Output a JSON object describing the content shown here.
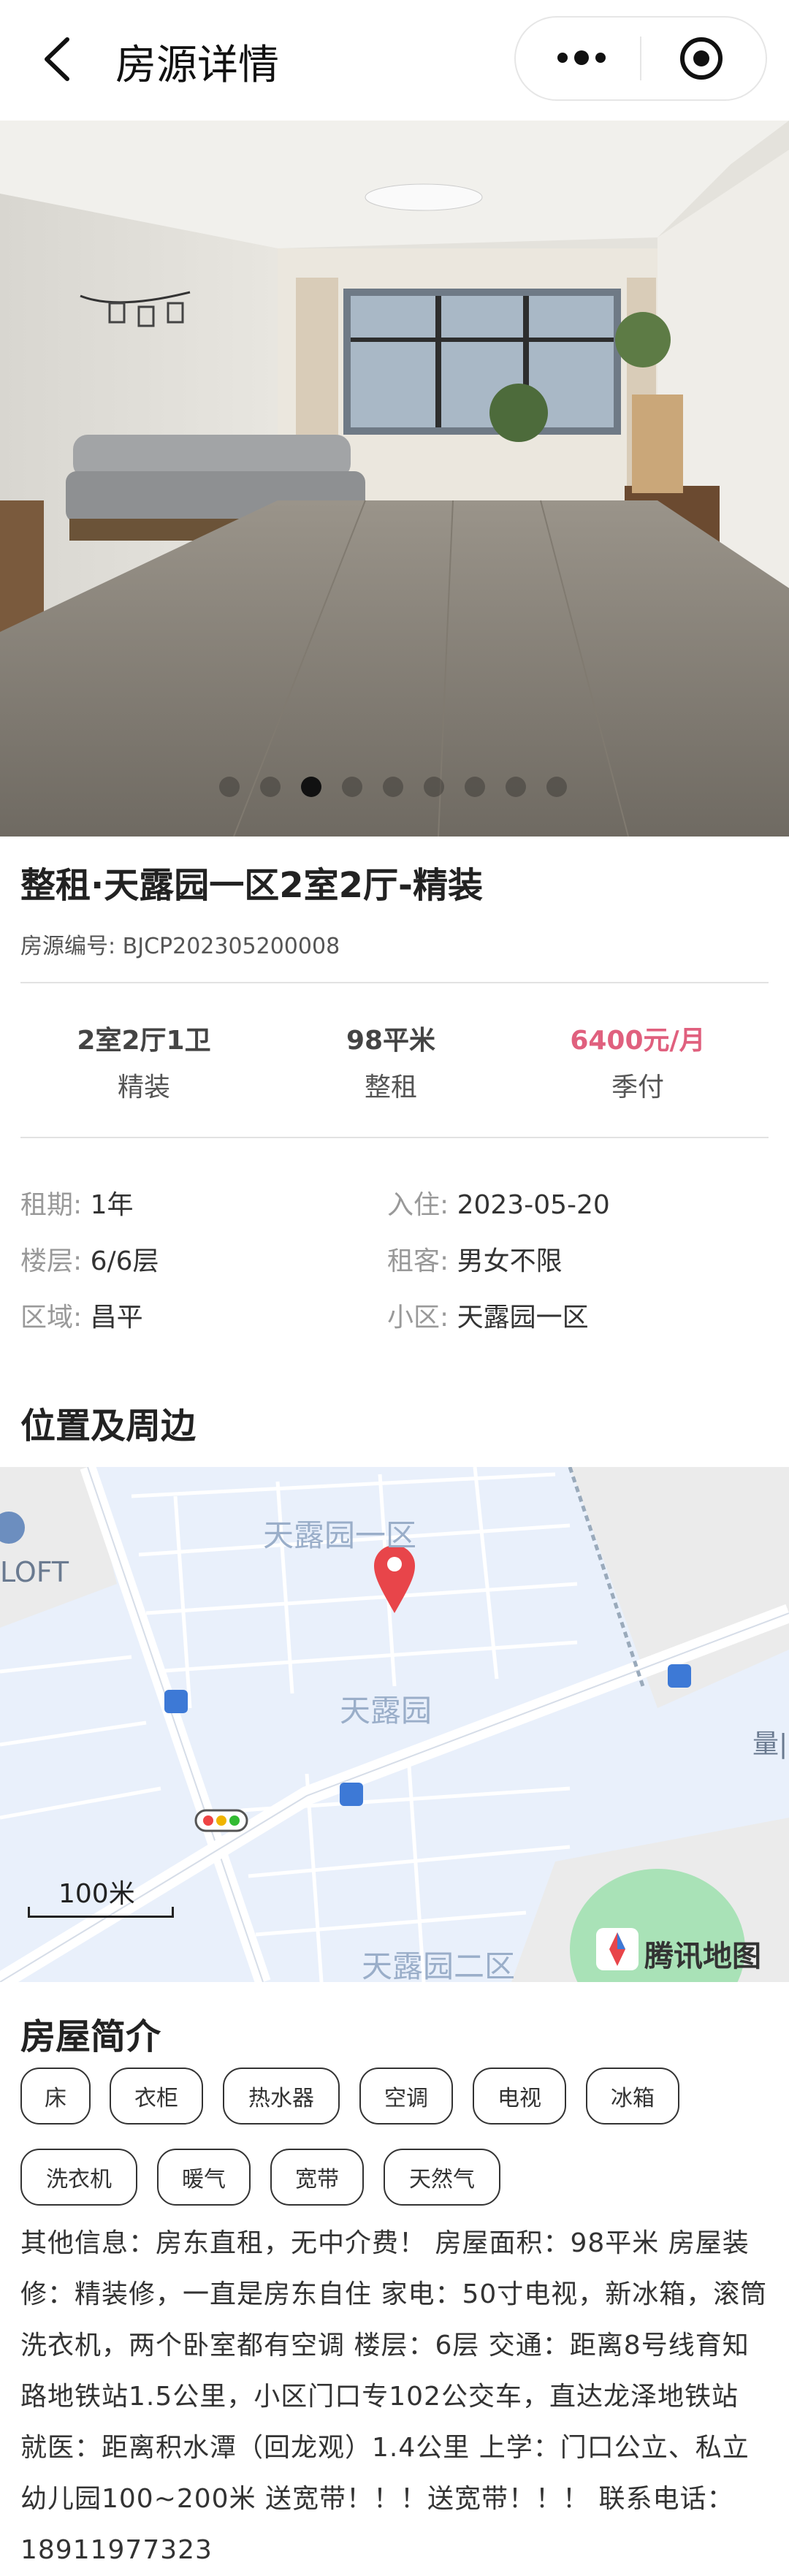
{
  "header": {
    "title": "房源详情"
  },
  "gallery": {
    "image_count": 9,
    "active_index": 2
  },
  "listing": {
    "title": "整租·天露园一区2室2厅-精装",
    "code_label": "房源编号: BJCP202305200008",
    "specs": [
      {
        "value": "2室2厅1卫",
        "sub": "精装"
      },
      {
        "value": "98平米",
        "sub": "整租"
      },
      {
        "value": "6400元/月",
        "sub": "季付"
      }
    ],
    "details": [
      {
        "key": "租期:",
        "value": "1年"
      },
      {
        "key": "入住:",
        "value": "2023-05-20"
      },
      {
        "key": "楼层:",
        "value": "6/6层"
      },
      {
        "key": "租客:",
        "value": "男女不限"
      },
      {
        "key": "区域:",
        "value": "昌平"
      },
      {
        "key": "小区:",
        "value": "天露园一区"
      }
    ]
  },
  "location": {
    "section_title": "位置及周边",
    "map": {
      "labels": [
        "天露园一区",
        "天露园",
        "天露园二区",
        "LOFT",
        "量|"
      ],
      "scale": "100米",
      "provider": "腾讯地图"
    }
  },
  "intro": {
    "section_title": "房屋简介",
    "tags": [
      "床",
      "衣柜",
      "热水器",
      "空调",
      "电视",
      "冰箱",
      "洗衣机",
      "暖气",
      "宽带",
      "天然气"
    ],
    "description": "其他信息：房东直租，无中介费！ 房屋面积：98平米 房屋装修：精装修，一直是房东自住 家电：50寸电视，新冰箱，滚筒洗衣机，两个卧室都有空调 楼层：6层 交通：距离8号线育知路地铁站1.5公里，小区门口专102公交车，直达龙泽地铁站 就医：距离积水潭（回龙观）1.4公里 上学：门口公立、私立幼儿园100~200米 送宽带！！！送宽带！！！ 联系电话：18911977323"
  },
  "colors": {
    "price": "#e0607e",
    "map_bg": "#e9f0fb",
    "pin": "#e8454a"
  }
}
